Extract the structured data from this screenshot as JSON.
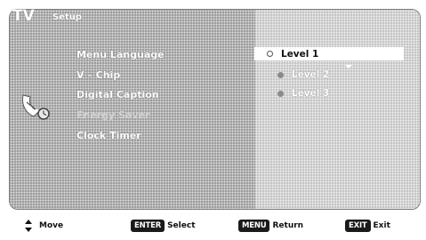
{
  "header": {
    "app": "TV",
    "section": "Setup"
  },
  "menu": {
    "items": [
      {
        "label": "Menu Language",
        "state": "enabled"
      },
      {
        "label": "V – Chip",
        "state": "enabled"
      },
      {
        "label": "Digital Caption",
        "state": "enabled"
      },
      {
        "label": "Energy Saver",
        "state": "disabled"
      },
      {
        "label": "Clock Timer",
        "state": "enabled"
      }
    ]
  },
  "options": {
    "items": [
      {
        "label": "Level 1",
        "selected": true
      },
      {
        "label": "Level 2",
        "selected": false
      },
      {
        "label": "Level 3",
        "selected": false
      }
    ]
  },
  "footer": {
    "move": "Move",
    "enter_key": "ENTER",
    "enter_label": "Select",
    "menu_key": "MENU",
    "menu_label": "Return",
    "exit_key": "EXIT",
    "exit_label": "Exit"
  },
  "icons": {
    "setup": "satellite-dish-icon",
    "left_arrow": "left-arrow-icon",
    "down_arrow": "down-arrow-icon",
    "move": "up-down-arrows-icon"
  },
  "colors": {
    "panel_left": "#9c9c9c",
    "panel_right": "#c4c4c4",
    "highlight": "#ffffff",
    "key_bg": "#1a1a1a"
  }
}
